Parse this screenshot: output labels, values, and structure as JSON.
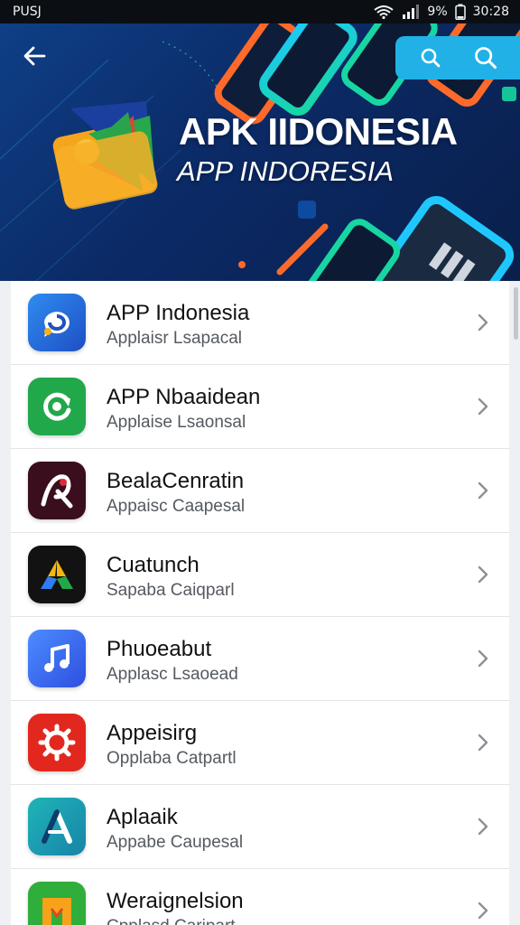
{
  "status_bar": {
    "carrier": "PUSJ",
    "battery": "9%",
    "time": "30:28"
  },
  "header": {
    "title": "APK IIDONESIA",
    "subtitle": "APP INDORESIA"
  },
  "colors": {
    "hero_bg": "#0b2a66",
    "actions_bg": "#21b1e6",
    "list_bg": "#ffffff"
  },
  "apps": [
    {
      "name": "APP Indonesia",
      "subtitle": "Applaisr Lsapacal",
      "icon": "speech-bubble-icon",
      "color": "#1e6fd8"
    },
    {
      "name": "APP Nbaaidean",
      "subtitle": "Applaise Lsaonsal",
      "icon": "refresh-icon",
      "color": "#1fa84a"
    },
    {
      "name": "BealaCenratin",
      "subtitle": "Appaisc Caapesal",
      "icon": "letter-a-icon",
      "color": "#3b0f1e"
    },
    {
      "name": "Cuatunch",
      "subtitle": "Sapaba Caiqparl",
      "icon": "triangle-logo-icon",
      "color": "#111111"
    },
    {
      "name": "Phuoeabut",
      "subtitle": "Applasc Lsaoead",
      "icon": "music-note-icon",
      "color": "#3a6cf0"
    },
    {
      "name": "Appeisirg",
      "subtitle": "Opplaba Catpartl",
      "icon": "gear-icon",
      "color": "#e02a20"
    },
    {
      "name": "Aplaaik",
      "subtitle": "Appabe Caupesal",
      "icon": "letter-a-icon",
      "color": "#1aa6b0"
    },
    {
      "name": "Weraignelsion",
      "subtitle": "Cpplasd Caripart",
      "icon": "letter-m-icon",
      "color": "#2fae3c"
    }
  ]
}
